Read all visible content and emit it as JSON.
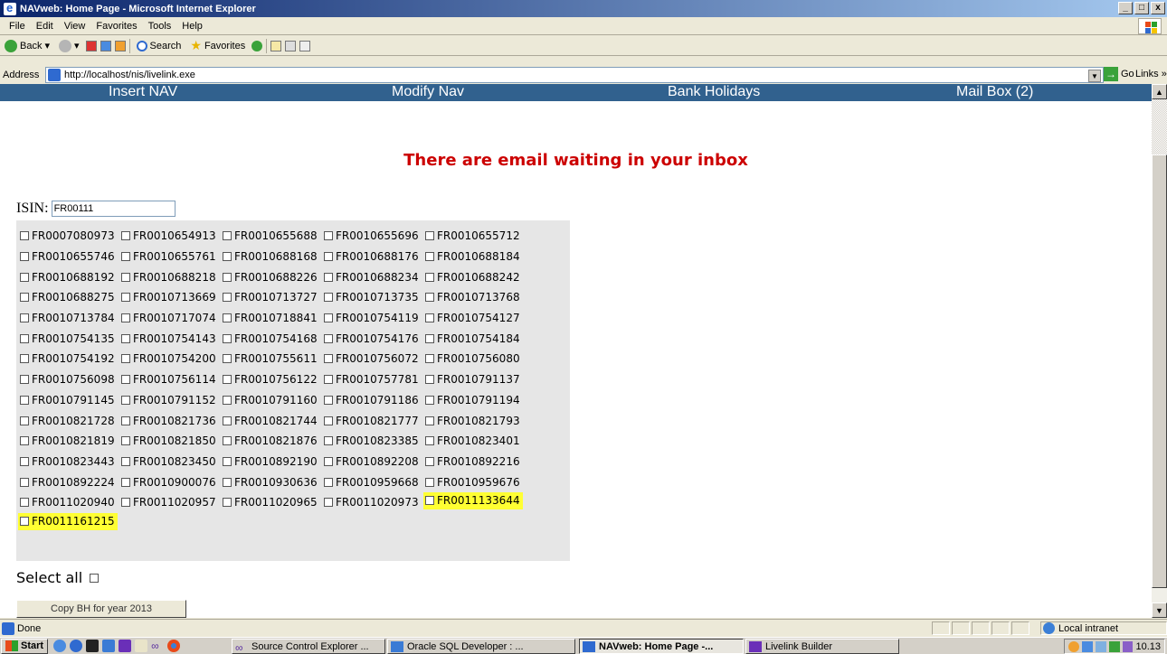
{
  "window": {
    "title": "NAVweb: Home Page - Microsoft Internet Explorer",
    "buttons": [
      "_",
      "□",
      "x"
    ]
  },
  "menu": [
    "File",
    "Edit",
    "View",
    "Favorites",
    "Tools",
    "Help"
  ],
  "toolbar": {
    "back": "Back",
    "search": "Search",
    "favorites": "Favorites"
  },
  "address": {
    "label": "Address",
    "url": "http://localhost/nis/livelink.exe",
    "go": "Go",
    "links": "Links"
  },
  "nav": [
    "Insert NAV",
    "Modify Nav",
    "Bank Holidays",
    "Mail Box (2)"
  ],
  "alert": "There are email waiting in your inbox",
  "isin": {
    "label": "ISIN:",
    "value": "FR00111"
  },
  "isin_options": [
    "FR0007080973",
    "FR0010654913",
    "FR0010655688",
    "FR0010655696",
    "FR0010655712",
    "FR0010655746",
    "FR0010655761",
    "FR0010688168",
    "FR0010688176",
    "FR0010688184",
    "FR0010688192",
    "FR0010688218",
    "FR0010688226",
    "FR0010688234",
    "FR0010688242",
    "FR0010688275",
    "FR0010713669",
    "FR0010713727",
    "FR0010713735",
    "FR0010713768",
    "FR0010713784",
    "FR0010717074",
    "FR0010718841",
    "FR0010754119",
    "FR0010754127",
    "FR0010754135",
    "FR0010754143",
    "FR0010754168",
    "FR0010754176",
    "FR0010754184",
    "FR0010754192",
    "FR0010754200",
    "FR0010755611",
    "FR0010756072",
    "FR0010756080",
    "FR0010756098",
    "FR0010756114",
    "FR0010756122",
    "FR0010757781",
    "FR0010791137",
    "FR0010791145",
    "FR0010791152",
    "FR0010791160",
    "FR0010791186",
    "FR0010791194",
    "FR0010821728",
    "FR0010821736",
    "FR0010821744",
    "FR0010821777",
    "FR0010821793",
    "FR0010821819",
    "FR0010821850",
    "FR0010821876",
    "FR0010823385",
    "FR0010823401",
    "FR0010823443",
    "FR0010823450",
    "FR0010892190",
    "FR0010892208",
    "FR0010892216",
    "FR0010892224",
    "FR0010900076",
    "FR0010930636",
    "FR0010959668",
    "FR0010959676",
    "FR0011020940",
    "FR0011020957",
    "FR0011020965",
    "FR0011020973",
    "FR0011133644",
    "FR0011161215"
  ],
  "highlighted": [
    "FR0011133644",
    "FR0011161215"
  ],
  "select_all": "Select all",
  "copy_button": "Copy BH for year 2013",
  "status": {
    "text": "Done",
    "zone": "Local intranet"
  },
  "taskbar": {
    "start": "start",
    "tasks": [
      "Source Control Explorer ...",
      "Oracle SQL Developer : ...",
      "NAVweb: Home Page -...",
      "Livelink Builder"
    ],
    "clock": "10.13"
  },
  "colors": {
    "nav_bg": "#31618e",
    "alert": "#cc0000",
    "highlight": "#ffff33",
    "panel": "#e6e6e6"
  }
}
